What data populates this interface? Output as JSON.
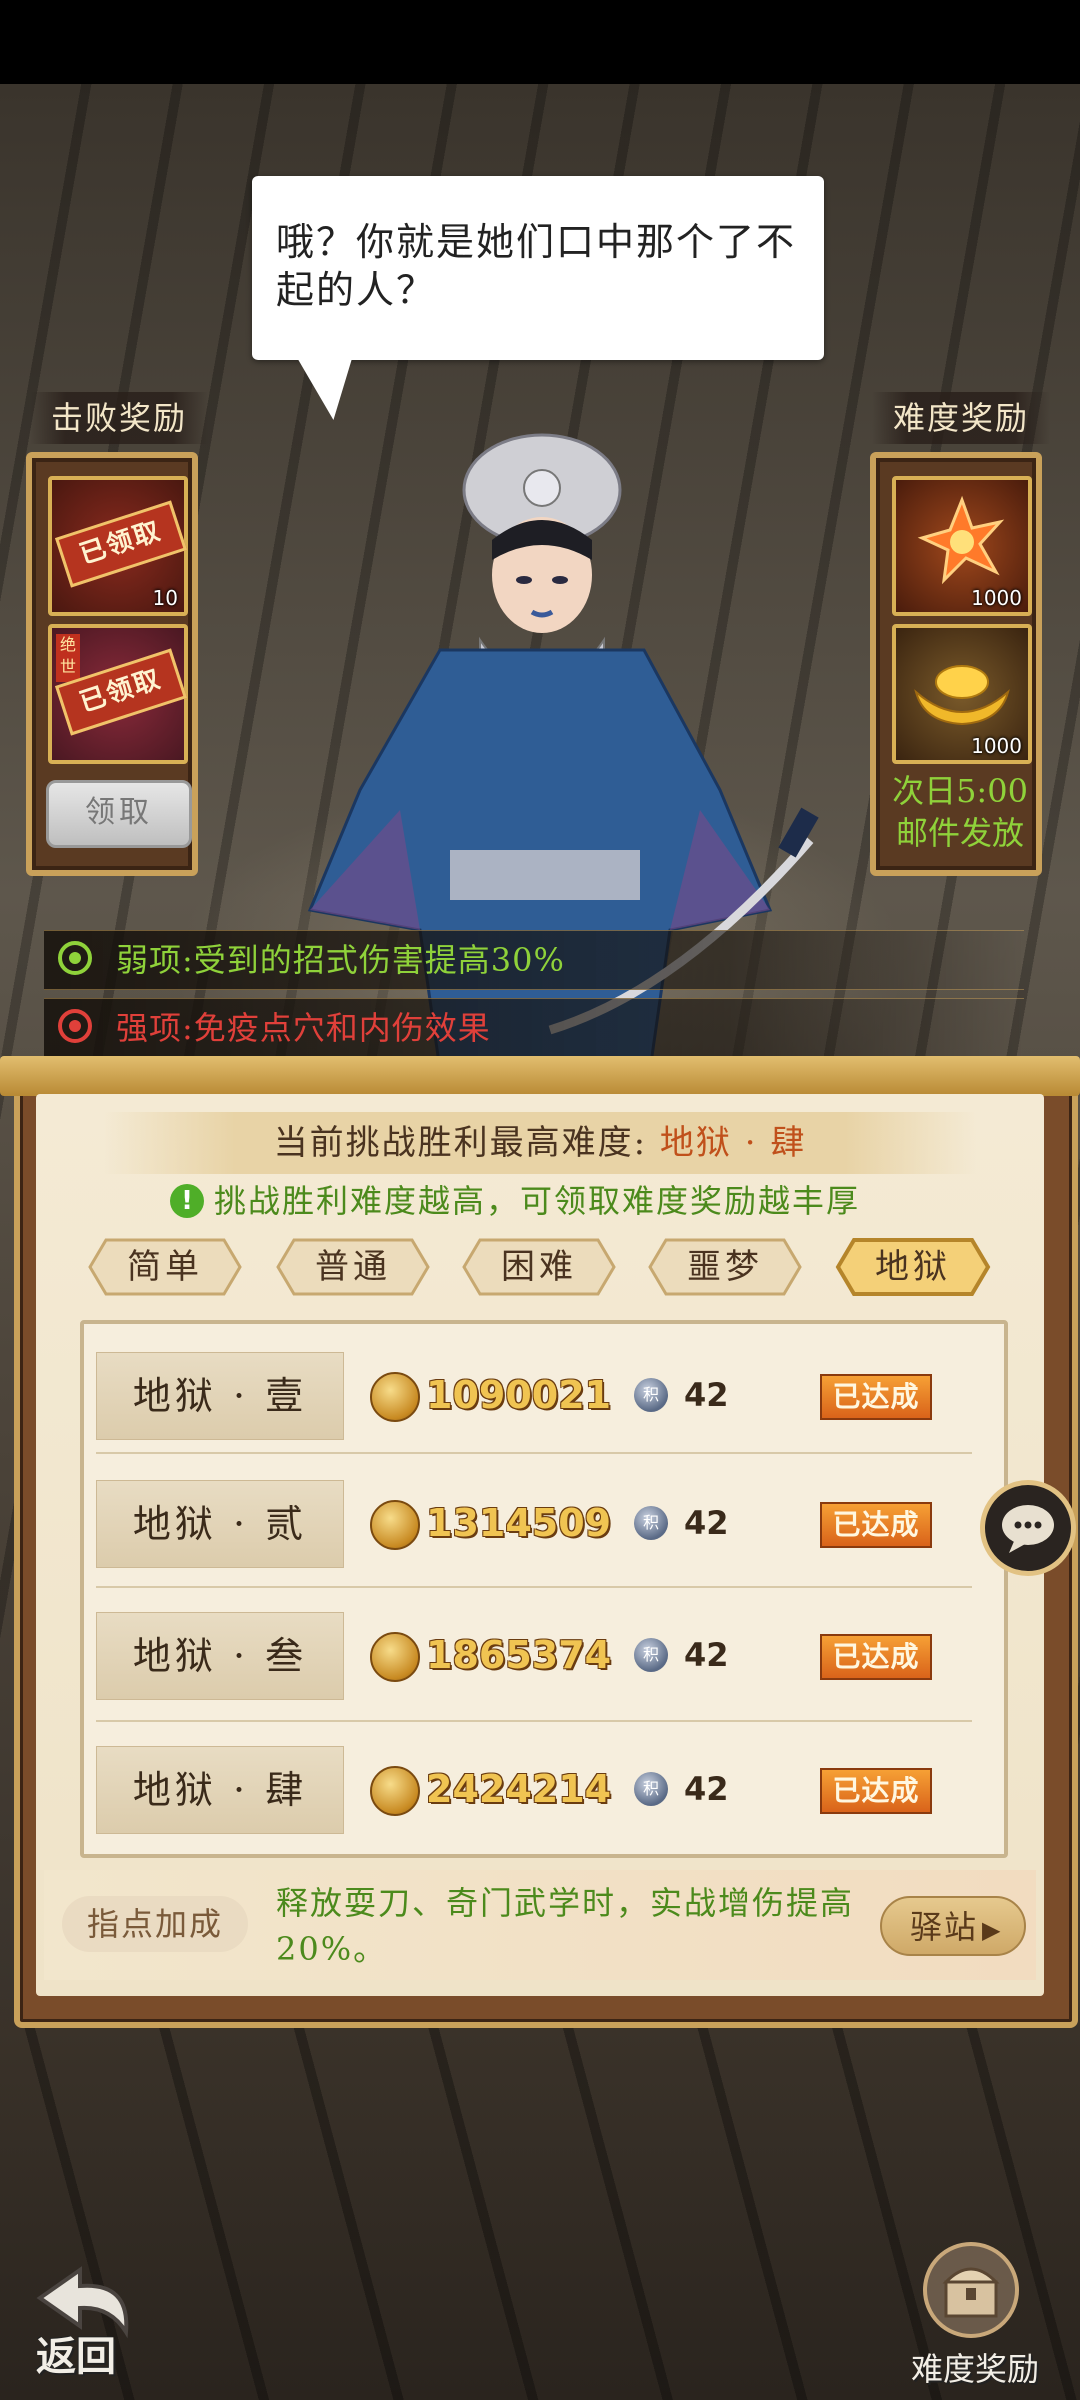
{
  "dialogue": "哦？你就是她们口中那个了不起的人？",
  "left_panel": {
    "title": "击败奖励",
    "items": [
      {
        "stamp": "已领取",
        "count": "10",
        "badge": ""
      },
      {
        "stamp": "已领取",
        "count": "",
        "badge": "绝世"
      }
    ],
    "claim_button": "领取"
  },
  "right_panel": {
    "title": "难度奖励",
    "items": [
      {
        "item": "flame-crystal",
        "count": "1000"
      },
      {
        "item": "gold-ingot",
        "count": "1000"
      }
    ],
    "note_line1": "次日5:00",
    "note_line2": "邮件发放"
  },
  "traits": {
    "weak": "弱项:受到的招式伤害提高30%",
    "strong": "强项:免疫点穴和内伤效果"
  },
  "challenge": {
    "banner_prefix": "当前挑战胜利最高难度:",
    "banner_value": "地狱 · 肆",
    "hint": "挑战胜利难度越高，可领取难度奖励越丰厚",
    "tabs": [
      "简单",
      "普通",
      "困难",
      "噩梦",
      "地狱"
    ],
    "active_tab": 4,
    "levels": [
      {
        "name": "地狱 · 壹",
        "score": "1090021",
        "points": "42",
        "status": "已达成"
      },
      {
        "name": "地狱 · 贰",
        "score": "1314509",
        "points": "42",
        "status": "已达成"
      },
      {
        "name": "地狱 · 叁",
        "score": "1865374",
        "points": "42",
        "status": "已达成"
      },
      {
        "name": "地狱 · 肆",
        "score": "2424214",
        "points": "42",
        "status": "已达成"
      }
    ],
    "points_icon_char": "积"
  },
  "bonus": {
    "label": "指点加成",
    "text": "释放耍刀、奇门武学时，实战增伤提高20%。",
    "station_button": "驿站"
  },
  "bottom": {
    "back_label": "返回",
    "difficulty_reward_label": "难度奖励"
  },
  "colors": {
    "weak": "#8fd23a",
    "strong": "#e0403a",
    "accent_gold": "#c9a15a",
    "hint_green": "#4c8a1c"
  }
}
